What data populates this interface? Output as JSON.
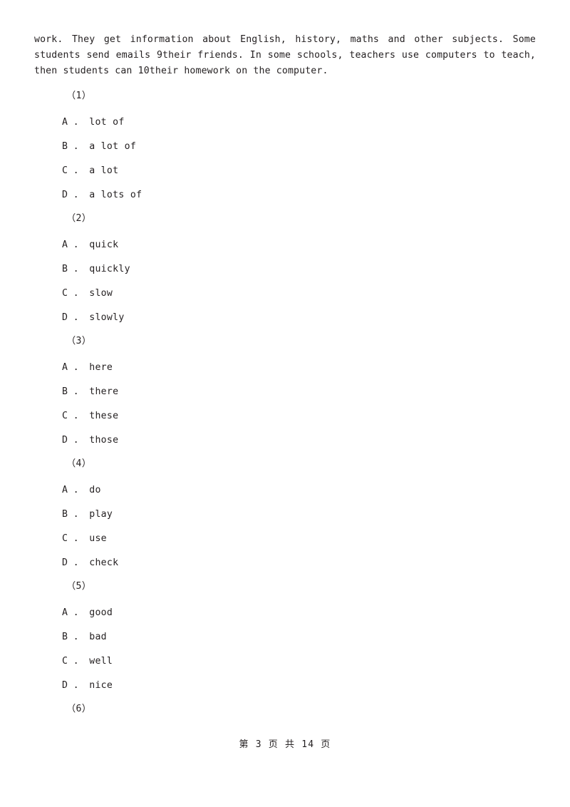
{
  "document": {
    "passage_text": "work. They get information about English, history, maths and other subjects. Some students send emails 9their friends. In some schools, teachers use computers to teach, then students can 10their homework on the computer.",
    "questions": [
      {
        "number": "（1）",
        "options": [
          "A ． lot of",
          "B ． a lot of",
          "C ． a lot",
          "D ． a lots of"
        ]
      },
      {
        "number": "（2）",
        "options": [
          "A ． quick",
          "B ． quickly",
          "C ． slow",
          "D ． slowly"
        ]
      },
      {
        "number": "（3）",
        "options": [
          "A ． here",
          "B ． there",
          "C ． these",
          "D ． those"
        ]
      },
      {
        "number": "（4）",
        "options": [
          "A ． do",
          "B ． play",
          "C ． use",
          "D ． check"
        ]
      },
      {
        "number": "（5）",
        "options": [
          "A ． good",
          "B ． bad",
          "C ． well",
          "D ． nice"
        ]
      },
      {
        "number": "（6）",
        "options": []
      }
    ],
    "footer": {
      "text": "第 3 页 共 14 页",
      "current_page": "3",
      "total_pages": "14"
    }
  }
}
